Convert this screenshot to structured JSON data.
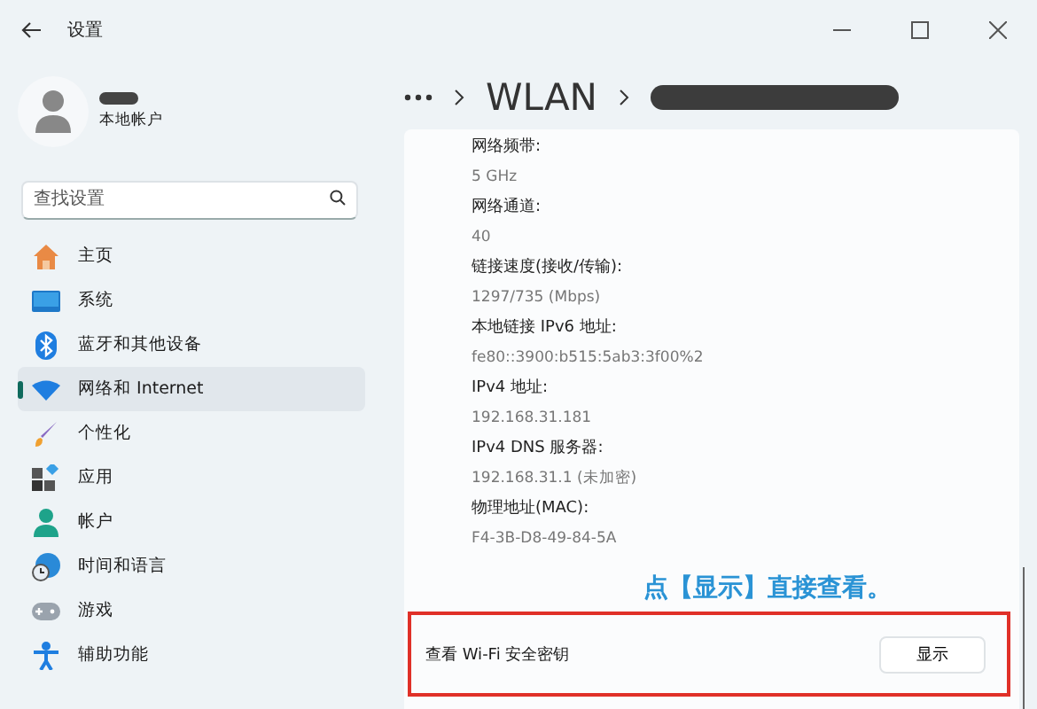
{
  "window": {
    "title": "设置"
  },
  "account": {
    "type": "本地帐户"
  },
  "search": {
    "placeholder": "查找设置"
  },
  "nav": [
    {
      "label": "主页",
      "selected": false
    },
    {
      "label": "系统",
      "selected": false
    },
    {
      "label": "蓝牙和其他设备",
      "selected": false
    },
    {
      "label": "网络和 Internet",
      "selected": true
    },
    {
      "label": "个性化",
      "selected": false
    },
    {
      "label": "应用",
      "selected": false
    },
    {
      "label": "帐户",
      "selected": false
    },
    {
      "label": "时间和语言",
      "selected": false
    },
    {
      "label": "游戏",
      "selected": false
    },
    {
      "label": "辅助功能",
      "selected": false
    }
  ],
  "breadcrumb": {
    "current": "WLAN"
  },
  "properties": [
    {
      "label": "网络频带:",
      "value": "5 GHz"
    },
    {
      "label": "网络通道:",
      "value": "40"
    },
    {
      "label": "链接速度(接收/传输):",
      "value": "1297/735 (Mbps)"
    },
    {
      "label": "本地链接 IPv6 地址:",
      "value": "fe80::3900:b515:5ab3:3f00%2"
    },
    {
      "label": "IPv4 地址:",
      "value": "192.168.31.181"
    },
    {
      "label": "IPv4 DNS 服务器:",
      "value": "192.168.31.1 (未加密)"
    },
    {
      "label": "物理地址(MAC):",
      "value": "F4-3B-D8-49-84-5A"
    }
  ],
  "annotation": "点【显示】直接查看。",
  "security_key": {
    "label": "查看 Wi-Fi 安全密钥",
    "button": "显示"
  }
}
